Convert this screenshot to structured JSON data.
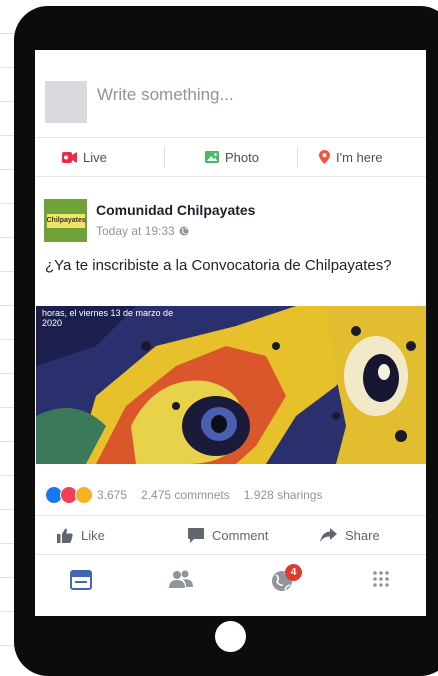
{
  "composer": {
    "placeholder": "Write something..."
  },
  "actions": [
    {
      "label": "Live",
      "icon": "video-camera-icon",
      "color": "#f02849"
    },
    {
      "label": "Photo",
      "icon": "photo-icon",
      "color": "#45bd62"
    },
    {
      "label": "I'm here",
      "icon": "location-pin-icon",
      "color": "#f5533d"
    }
  ],
  "post": {
    "page_name": "Comunidad Chilpayates",
    "avatar_text": "Chilpayates",
    "time": "Today at 19:33",
    "privacy_icon": "globe-icon",
    "text": "¿Ya te inscribiste a la Convocatoria de Chilpayates?",
    "image_caption_line1": "horas, el viernes 13 de marzo de",
    "image_caption_line2": "2020"
  },
  "stats": {
    "reactions": "3.675",
    "comments": "2.475 commnets",
    "shares": "1.928 sharings",
    "reaction_icons": [
      "like-reaction-icon",
      "love-reaction-icon",
      "wow-reaction-icon"
    ]
  },
  "post_actions": [
    {
      "label": "Like",
      "icon": "thumbs-up-icon"
    },
    {
      "label": "Comment",
      "icon": "comment-icon"
    },
    {
      "label": "Share",
      "icon": "share-arrow-icon"
    }
  ],
  "nav": {
    "items": [
      "news-feed-icon",
      "friends-icon",
      "notifications-globe-icon",
      "menu-grid-icon"
    ],
    "notification_count": "4",
    "active_color": "#4267b2",
    "inactive_color": "#90949c"
  },
  "colors": {
    "device": "#0c0c0c",
    "text_primary": "#1d2129",
    "text_secondary": "#90949c"
  }
}
